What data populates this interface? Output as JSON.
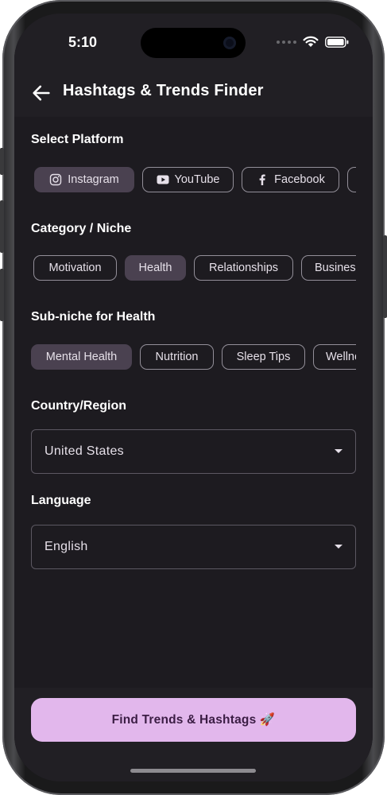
{
  "status_bar": {
    "time": "5:10"
  },
  "app_bar": {
    "title": "Hashtags & Trends Finder",
    "back_icon": "arrow-left-icon"
  },
  "platform": {
    "heading": "Select Platform",
    "chips": [
      {
        "label": "Instagram",
        "icon": "instagram-icon",
        "selected": true
      },
      {
        "label": "YouTube",
        "icon": "youtube-icon",
        "selected": false
      },
      {
        "label": "Facebook",
        "icon": "facebook-icon",
        "selected": false
      }
    ]
  },
  "category": {
    "heading": "Category / Niche",
    "chips": [
      {
        "label": "Motivation",
        "selected": false
      },
      {
        "label": "Health",
        "selected": true
      },
      {
        "label": "Relationships",
        "selected": false
      },
      {
        "label": "Business",
        "selected": false
      }
    ]
  },
  "subniche": {
    "heading": "Sub-niche for Health",
    "chips": [
      {
        "label": "Mental Health",
        "selected": true
      },
      {
        "label": "Nutrition",
        "selected": false
      },
      {
        "label": "Sleep Tips",
        "selected": false
      },
      {
        "label": "Wellness",
        "selected": false
      }
    ]
  },
  "country": {
    "heading": "Country/Region",
    "value": "United States"
  },
  "language": {
    "heading": "Language",
    "value": "English"
  },
  "action": {
    "label": "Find Trends & Hashtags 🚀"
  },
  "colors": {
    "background": "#1d1b20",
    "surface": "#211f24",
    "chip_selected": "#4a4150",
    "primary_button": "#e2b7ec",
    "primary_button_text": "#3b1d44"
  }
}
